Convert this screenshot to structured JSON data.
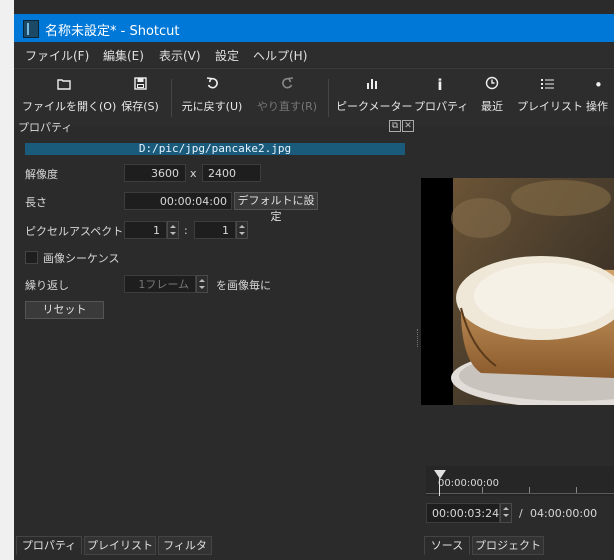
{
  "window": {
    "title": "名称未設定* - Shotcut"
  },
  "menu": [
    {
      "label": "ファイル(F)"
    },
    {
      "label": "編集(E)"
    },
    {
      "label": "表示(V)"
    },
    {
      "label": "設定"
    },
    {
      "label": "ヘルプ(H)"
    }
  ],
  "toolbar": [
    {
      "label": "ファイルを開く(O)",
      "icon": "folder-open-icon"
    },
    {
      "label": "保存(S)",
      "icon": "save-icon"
    },
    {
      "label": "元に戻す(U)",
      "icon": "undo-icon"
    },
    {
      "label": "やり直す(R)",
      "icon": "redo-icon",
      "disabled": true
    },
    {
      "label": "ピークメーター",
      "icon": "peak-meter-icon"
    },
    {
      "label": "プロパティ",
      "icon": "info-icon"
    },
    {
      "label": "最近",
      "icon": "clock-icon"
    },
    {
      "label": "プレイリスト",
      "icon": "list-icon"
    },
    {
      "label": "操作",
      "icon": "tools-icon"
    }
  ],
  "panel": {
    "title": "プロパティ"
  },
  "properties": {
    "file": "D:/pic/jpg/pancake2.jpg",
    "resolution_label": "解像度",
    "width": "3600",
    "x_sep": "x",
    "height": "2400",
    "length_label": "長さ",
    "length": "00:00:04:00",
    "default_button": "デフォルトに設定",
    "par_label": "ピクセルアスペクト比",
    "par_num": "1",
    "par_sep": ":",
    "par_den": "1",
    "sequence_label": "画像シーケンス",
    "sequence_checked": false,
    "repeat_label": "繰り返し",
    "repeat_value": "1フレーム",
    "repeat_suffix": "を画像毎に",
    "reset_button": "リセット"
  },
  "player": {
    "ruler_start": "00:00:00:00",
    "position": "00:00:03:24",
    "slash": "/",
    "duration": "04:00:00:00"
  },
  "tabs_left": [
    {
      "label": "プロパティ",
      "active": true
    },
    {
      "label": "プレイリスト"
    },
    {
      "label": "フィルタ"
    }
  ],
  "tabs_right": [
    {
      "label": "ソース",
      "active": true
    },
    {
      "label": "プロジェクト"
    }
  ],
  "colors": {
    "accent": "#0078d7",
    "file_bar": "#1a5a7a"
  }
}
